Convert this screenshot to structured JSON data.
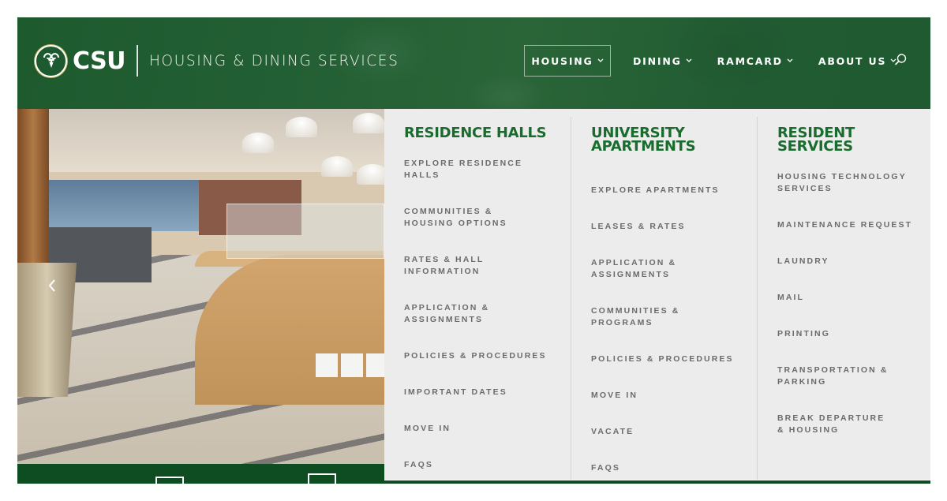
{
  "header": {
    "logo_text": "CSU",
    "department": "HOUSING & DINING SERVICES",
    "brand_color": "#1f5a30"
  },
  "nav": {
    "items": [
      {
        "label": "HOUSING",
        "active": true
      },
      {
        "label": "DINING",
        "active": false
      },
      {
        "label": "RAMCARD",
        "active": false
      },
      {
        "label": "ABOUT US",
        "active": false
      }
    ],
    "search_icon": "search-icon"
  },
  "mega_menu": {
    "accent_color": "#1a6b2e",
    "columns": [
      {
        "title": "RESIDENCE HALLS",
        "links": [
          "EXPLORE RESIDENCE HALLS",
          "COMMUNITIES & HOUSING OPTIONS",
          "RATES & HALL INFORMATION",
          "APPLICATION & ASSIGNMENTS",
          "POLICIES & PROCEDURES",
          "IMPORTANT DATES",
          "MOVE IN",
          "FAQS"
        ]
      },
      {
        "title": "UNIVERSITY APARTMENTS",
        "links": [
          "EXPLORE APARTMENTS",
          "LEASES & RATES",
          "APPLICATION & ASSIGNMENTS",
          "COMMUNITIES & PROGRAMS",
          "POLICIES & PROCEDURES",
          "MOVE IN",
          "VACATE",
          "FAQS"
        ]
      },
      {
        "title": "RESIDENT SERVICES",
        "links": [
          "HOUSING TECHNOLOGY SERVICES",
          "MAINTENANCE REQUEST",
          "LAUNDRY",
          "MAIL",
          "PRINTING",
          "TRANSPORTATION & PARKING",
          "BREAK DEPARTURE & HOUSING"
        ]
      }
    ]
  },
  "hero": {
    "image_description": "dining hall interior",
    "prev_icon": "chevron-left-icon"
  }
}
